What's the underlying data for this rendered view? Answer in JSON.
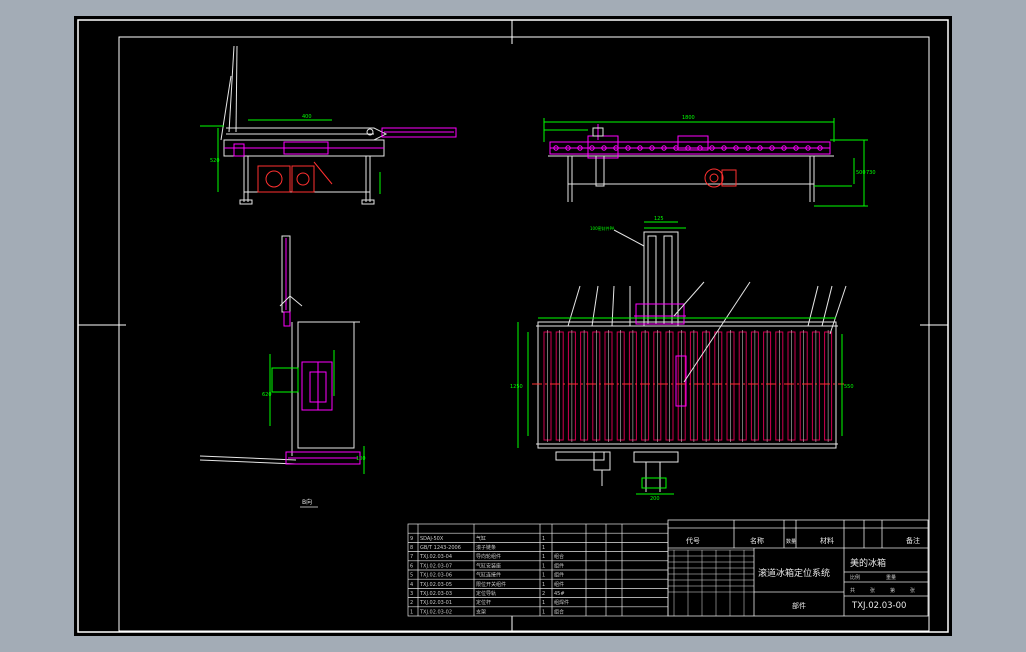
{
  "colors": {
    "workspace": "#a3acb6",
    "sheet": "#000000",
    "frame": "#ffffff",
    "outline": "#e6e6e6",
    "dimension": "#00ff00",
    "part": "#ff00ff",
    "center_line": "#ff3030",
    "roller": "#d00050"
  },
  "drawing": {
    "view_label": "B向",
    "title_block": {
      "drawing_name": "滚道冰箱定位系统",
      "company": "美的冰箱",
      "drawing_number": "TXJ.02.03-00",
      "part_label": "部件",
      "header": [
        "代号",
        "名称",
        "数量",
        "材料",
        "备注"
      ],
      "scale_row": [
        "比例",
        "重量"
      ],
      "sheet_row": [
        "共",
        "张",
        "第",
        "张"
      ]
    },
    "parts_list": [
      {
        "no": "1",
        "code": "TXJ.02.03-02",
        "name": "支架",
        "qty": "1",
        "material": "组合"
      },
      {
        "no": "2",
        "code": "TXJ.02.03-01",
        "name": "定位杆",
        "qty": "1",
        "material": "组焊件"
      },
      {
        "no": "3",
        "code": "TXJ.02.03-03",
        "name": "定位导轨",
        "qty": "2",
        "material": "45#"
      },
      {
        "no": "4",
        "code": "TXJ.02.03-05",
        "name": "限位开关组件",
        "qty": "1",
        "material": "组件"
      },
      {
        "no": "5",
        "code": "TXJ.02.03-06",
        "name": "气缸连接件",
        "qty": "1",
        "material": "组件"
      },
      {
        "no": "6",
        "code": "TXJ.02.03-07",
        "name": "气缸安装座",
        "qty": "1",
        "material": "组件"
      },
      {
        "no": "7",
        "code": "TXJ.02.03-04",
        "name": "导向轮组件",
        "qty": "1",
        "material": "组合"
      },
      {
        "no": "8",
        "code": "GB/T 1243-2006",
        "name": "滚子链条",
        "qty": "1",
        "material": ""
      },
      {
        "no": "9",
        "code": "SDAJ-50X",
        "name": "气缸",
        "qty": "1",
        "material": ""
      }
    ],
    "dims_top_right": [
      "1800",
      "500",
      "730"
    ],
    "dims_plan": [
      "1250",
      "500",
      "125",
      "550",
      "750"
    ],
    "dims_left": [
      "400",
      "100",
      "520",
      "620"
    ],
    "callout_text": "100密封件PA"
  }
}
